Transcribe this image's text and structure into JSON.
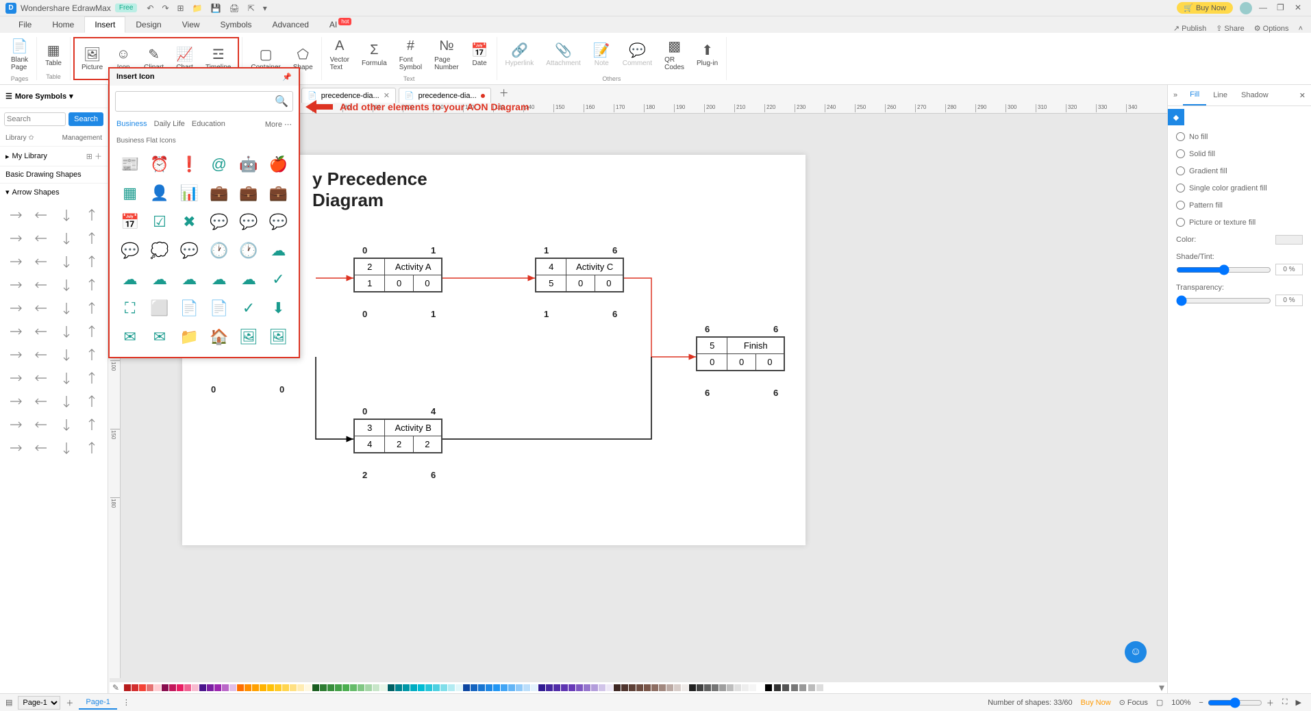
{
  "app": {
    "title": "Wondershare EdrawMax",
    "badge": "Free",
    "buynow": "Buy Now"
  },
  "menubar": {
    "items": [
      "File",
      "Home",
      "Insert",
      "Design",
      "View",
      "Symbols",
      "Advanced",
      "AI"
    ],
    "active": 2,
    "right": {
      "publish": "Publish",
      "share": "Share",
      "options": "Options"
    }
  },
  "ribbon": {
    "groups": [
      {
        "label": "Pages",
        "buttons": [
          {
            "name": "blank-page",
            "label": "Blank\nPage",
            "icon": "📄"
          }
        ]
      },
      {
        "label": "Table",
        "buttons": [
          {
            "name": "table",
            "label": "Table",
            "icon": "▦"
          }
        ]
      },
      {
        "label": "",
        "highlight": true,
        "buttons": [
          {
            "name": "picture",
            "label": "Picture",
            "icon": "🖼"
          },
          {
            "name": "icon",
            "label": "Icon",
            "icon": "☺"
          },
          {
            "name": "clipart",
            "label": "Clipart",
            "icon": "✎"
          },
          {
            "name": "chart",
            "label": "Chart",
            "icon": "📈"
          },
          {
            "name": "timeline",
            "label": "Timeline",
            "icon": "☲"
          }
        ]
      },
      {
        "label": "",
        "buttons": [
          {
            "name": "container",
            "label": "Container",
            "icon": "▢"
          },
          {
            "name": "shape",
            "label": "Shape",
            "icon": "⬠"
          }
        ]
      },
      {
        "label": "Text",
        "buttons": [
          {
            "name": "vector-text",
            "label": "Vector\nText",
            "icon": "A"
          },
          {
            "name": "formula",
            "label": "Formula",
            "icon": "Σ"
          },
          {
            "name": "font-symbol",
            "label": "Font\nSymbol",
            "icon": "#"
          },
          {
            "name": "page-number",
            "label": "Page\nNumber",
            "icon": "№"
          },
          {
            "name": "date",
            "label": "Date",
            "icon": "📅"
          }
        ]
      },
      {
        "label": "Others",
        "buttons": [
          {
            "name": "hyperlink",
            "label": "Hyperlink",
            "icon": "🔗",
            "disabled": true
          },
          {
            "name": "attachment",
            "label": "Attachment",
            "icon": "📎",
            "disabled": true
          },
          {
            "name": "note",
            "label": "Note",
            "icon": "📝",
            "disabled": true
          },
          {
            "name": "comment",
            "label": "Comment",
            "icon": "💬",
            "disabled": true
          },
          {
            "name": "qr-codes",
            "label": "QR\nCodes",
            "icon": "▩"
          },
          {
            "name": "plugin",
            "label": "Plug-in",
            "icon": "⬆"
          }
        ]
      }
    ]
  },
  "sidebar": {
    "more_symbols": "More Symbols",
    "search_placeholder": "Search",
    "search_btn": "Search",
    "library_label": "Library",
    "management": "Management",
    "my_library": "My Library",
    "sections": [
      "Basic Drawing Shapes",
      "Arrow Shapes"
    ]
  },
  "icon_popup": {
    "title": "Insert Icon",
    "search_placeholder": "",
    "categories": [
      "Business",
      "Daily Life",
      "Education"
    ],
    "more": "More",
    "subheader": "Business Flat Icons",
    "icons": [
      "📰",
      "⏰",
      "❗",
      "@",
      "🤖",
      "🍎",
      "▦",
      "👤",
      "📊",
      "💼",
      "💼",
      "💼",
      "📅",
      "☑",
      "✖",
      "💬",
      "💬",
      "💬",
      "💬",
      "💭",
      "💬",
      "🕐",
      "🕐",
      "☁",
      "☁",
      "☁",
      "☁",
      "☁",
      "☁",
      "✓",
      "⛶",
      "⬜",
      "📄",
      "📄",
      "✓",
      "⬇",
      "✉",
      "✉",
      "📁",
      "🏠",
      "🖼",
      "🖼"
    ]
  },
  "tabs": [
    {
      "name": "precedence-dia...",
      "dirty": false
    },
    {
      "name": "precedence-dia...",
      "dirty": true
    }
  ],
  "ruler_h": [
    70,
    80,
    90,
    100,
    110,
    120,
    130,
    140,
    150,
    160,
    170,
    180,
    190,
    200,
    210,
    220,
    230,
    240,
    250,
    260,
    270,
    280,
    290,
    300,
    310,
    320,
    330,
    340
  ],
  "ruler_v": [
    100,
    150,
    180
  ],
  "callout": "Add other elements to your AON Diagram",
  "diagram": {
    "title_line1": "y Precedence",
    "title_line2": "Diagram",
    "nodes": {
      "A": {
        "id": "2",
        "name": "Activity A",
        "tl": "0",
        "tr": "1",
        "bl": "0",
        "br": "1",
        "r2a": "1",
        "r2b": "0",
        "r2c": "0"
      },
      "C": {
        "id": "4",
        "name": "Activity C",
        "tl": "1",
        "tr": "6",
        "bl": "1",
        "br": "6",
        "r2a": "5",
        "r2b": "0",
        "r2c": "0"
      },
      "B": {
        "id": "3",
        "name": "Activity B",
        "tl": "0",
        "tr": "4",
        "bl": "2",
        "br": "6",
        "r2a": "4",
        "r2b": "2",
        "r2c": "2"
      },
      "F": {
        "id": "5",
        "name": "Finish",
        "tl": "6",
        "tr": "6",
        "bl": "6",
        "br": "6",
        "r2a": "0",
        "r2b": "0",
        "r2c": "0"
      },
      "start_bl": "0",
      "start_br": "0"
    }
  },
  "right_panel": {
    "tabs": [
      "Fill",
      "Line",
      "Shadow"
    ],
    "fills": [
      "No fill",
      "Solid fill",
      "Gradient fill",
      "Single color gradient fill",
      "Pattern fill",
      "Picture or texture fill"
    ],
    "color_label": "Color:",
    "shade_label": "Shade/Tint:",
    "shade_val": "0 %",
    "trans_label": "Transparency:",
    "trans_val": "0 %"
  },
  "palette": [
    "#b71c1c",
    "#d32f2f",
    "#f44336",
    "#e57373",
    "#ffcdd2",
    "#880e4f",
    "#c2185b",
    "#e91e63",
    "#f06292",
    "#f8bbd0",
    "#4a148c",
    "#7b1fa2",
    "#9c27b0",
    "#ba68c8",
    "#e1bee7",
    "#ff6f00",
    "#ff8f00",
    "#ffa000",
    "#ffb300",
    "#ffc107",
    "#ffca28",
    "#ffd54f",
    "#ffe082",
    "#ffecb3",
    "#fff8e1",
    "#1b5e20",
    "#2e7d32",
    "#388e3c",
    "#43a047",
    "#4caf50",
    "#66bb6a",
    "#81c784",
    "#a5d6a7",
    "#c8e6c9",
    "#e8f5e9",
    "#006064",
    "#00838f",
    "#0097a7",
    "#00acc1",
    "#00bcd4",
    "#26c6da",
    "#4dd0e1",
    "#80deea",
    "#b2ebf2",
    "#e0f7fa",
    "#0d47a1",
    "#1565c0",
    "#1976d2",
    "#1e88e5",
    "#2196f3",
    "#42a5f5",
    "#64b5f6",
    "#90caf9",
    "#bbdefb",
    "#e3f2fd",
    "#311b92",
    "#4527a0",
    "#512da8",
    "#5e35b1",
    "#673ab7",
    "#7e57c2",
    "#9575cd",
    "#b39ddb",
    "#d1c4e9",
    "#ede7f6",
    "#3e2723",
    "#4e342e",
    "#5d4037",
    "#6d4c41",
    "#795548",
    "#8d6e63",
    "#a1887f",
    "#bcaaa4",
    "#d7ccc8",
    "#efebe9",
    "#212121",
    "#424242",
    "#616161",
    "#757575",
    "#9e9e9e",
    "#bdbdbd",
    "#e0e0e0",
    "#eeeeee",
    "#f5f5f5",
    "#ffffff"
  ],
  "statusbar": {
    "page_sel": "Page-1",
    "page_tab": "Page-1",
    "shapes": "Number of shapes: 33/60",
    "buynow": "Buy Now",
    "focus": "Focus",
    "zoom": "100%"
  }
}
